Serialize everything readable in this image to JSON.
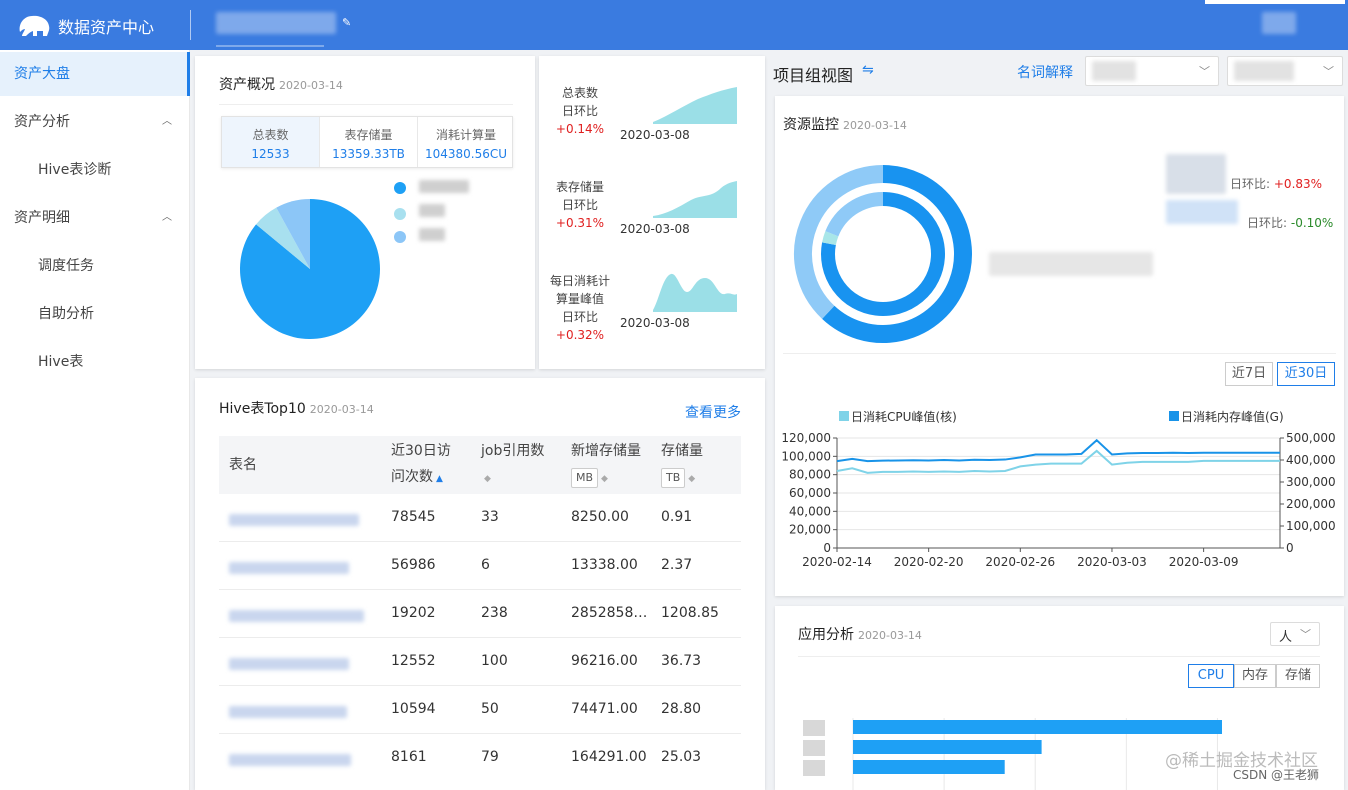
{
  "header": {
    "app_title": "数据资产中心",
    "edit_icon": "✎"
  },
  "sidebar": {
    "items": [
      {
        "label": "资产大盘"
      },
      {
        "label": "资产分析"
      },
      {
        "label": "Hive表诊断"
      },
      {
        "label": "资产明细"
      },
      {
        "label": "调度任务"
      },
      {
        "label": "自助分析"
      },
      {
        "label": "Hive表"
      }
    ]
  },
  "overview": {
    "title": "资产概况",
    "date": "2020-03-14",
    "tabs": [
      {
        "label": "总表数",
        "value": "12533"
      },
      {
        "label": "表存储量",
        "value": "13359.33TB"
      },
      {
        "label": "消耗计算量",
        "value": "104380.56CU"
      }
    ],
    "pie_shares": [
      0.86,
      0.06,
      0.08
    ],
    "colors": [
      "#1ea0f5",
      "#a8e0ef",
      "#8cc6f7"
    ]
  },
  "sparks": [
    {
      "label_lines": [
        "总表数",
        "日环比"
      ],
      "change": "+0.14%",
      "date": "2020-03-08"
    },
    {
      "label_lines": [
        "表存储量",
        "日环比"
      ],
      "change": "+0.31%",
      "date": "2020-03-08"
    },
    {
      "label_lines": [
        "每日消耗计",
        "算量峰值",
        "日环比"
      ],
      "change": "+0.32%",
      "date": "2020-03-08"
    }
  ],
  "hive_top": {
    "title": "Hive表Top10",
    "date": "2020-03-14",
    "more": "查看更多",
    "headers": {
      "name": "表名",
      "visits_l1": "近30日访",
      "visits_l2": "问次数",
      "jobs": "job引用数",
      "new_storage": "新增存储量",
      "new_storage_unit": "MB",
      "storage": "存储量",
      "storage_unit": "TB"
    },
    "rows": [
      {
        "visits": "78545",
        "jobs": "33",
        "new_storage": "8250.00",
        "storage": "0.91"
      },
      {
        "visits": "56986",
        "jobs": "6",
        "new_storage": "13338.00",
        "storage": "2.37"
      },
      {
        "visits": "19202",
        "jobs": "238",
        "new_storage": "2852858…",
        "storage": "1208.85"
      },
      {
        "visits": "12552",
        "jobs": "100",
        "new_storage": "96216.00",
        "storage": "36.73"
      },
      {
        "visits": "10594",
        "jobs": "50",
        "new_storage": "74471.00",
        "storage": "28.80"
      },
      {
        "visits": "8161",
        "jobs": "79",
        "new_storage": "164291.00",
        "storage": "25.03"
      }
    ]
  },
  "project": {
    "title": "项目组视图",
    "switch_icon": "⇋",
    "glossary": "名词解释"
  },
  "monitor": {
    "title": "资源监控",
    "date": "2020-03-14",
    "changes": [
      {
        "label": "日环比:",
        "value": "+0.83%",
        "dir": "up"
      },
      {
        "label": "日环比:",
        "value": "-0.10%",
        "dir": "down"
      }
    ],
    "ring_outer": [
      0.62,
      0.38
    ],
    "ring_inner": [
      0.78,
      0.03,
      0.19
    ],
    "range_buttons": [
      "近7日",
      "近30日"
    ],
    "legend": [
      "日消耗CPU峰值(核)",
      "日消耗内存峰值(G)"
    ],
    "colors": {
      "cpu": "#7fd3e8",
      "mem": "#1893e8",
      "ring_a": "#1893f0",
      "ring_b": "#8fcaf7",
      "ring_c": "#a8e6e8"
    }
  },
  "chart_data": {
    "type": "line",
    "x": [
      "2020-02-14",
      "2020-02-15",
      "2020-02-16",
      "2020-02-17",
      "2020-02-18",
      "2020-02-19",
      "2020-02-20",
      "2020-02-21",
      "2020-02-22",
      "2020-02-23",
      "2020-02-24",
      "2020-02-25",
      "2020-02-26",
      "2020-02-27",
      "2020-02-28",
      "2020-02-29",
      "2020-03-01",
      "2020-03-02",
      "2020-03-03",
      "2020-03-04",
      "2020-03-05",
      "2020-03-06",
      "2020-03-07",
      "2020-03-08",
      "2020-03-09",
      "2020-03-10",
      "2020-03-11",
      "2020-03-12",
      "2020-03-13",
      "2020-03-14"
    ],
    "x_ticks": [
      "2020-02-14",
      "2020-02-20",
      "2020-02-26",
      "2020-03-03",
      "2020-03-09"
    ],
    "series": [
      {
        "name": "日消耗CPU峰值(核)",
        "axis": "left",
        "values": [
          84000,
          87000,
          82000,
          83000,
          83000,
          83500,
          83000,
          83500,
          83000,
          84000,
          83500,
          84000,
          89000,
          91000,
          92000,
          92000,
          92000,
          106000,
          91000,
          93000,
          94000,
          94000,
          94000,
          94000,
          95000,
          95000,
          95000,
          95000,
          95000,
          95000
        ]
      },
      {
        "name": "日消耗内存峰值(G)",
        "axis": "right",
        "values": [
          395000,
          405000,
          395000,
          397000,
          398000,
          399000,
          398000,
          400000,
          398000,
          401000,
          400000,
          402000,
          412000,
          425000,
          425000,
          425000,
          428000,
          490000,
          425000,
          430000,
          432000,
          432000,
          433000,
          432000,
          433000,
          433000,
          433000,
          433000,
          433000,
          433000
        ]
      }
    ],
    "ylim_left": [
      0,
      120000
    ],
    "ylim_right": [
      0,
      500000
    ],
    "yticks_left": [
      "120,000",
      "100,000",
      "80,000",
      "60,000",
      "40,000",
      "20,000",
      "0"
    ],
    "yticks_right": [
      "500,000",
      "400,000",
      "300,000",
      "200,000",
      "100,000",
      "0"
    ]
  },
  "app_analysis": {
    "title": "应用分析",
    "date": "2020-03-14",
    "dropdown": "人",
    "tabs": [
      "CPU",
      "内存",
      "存储"
    ],
    "bars": [
      0.9,
      0.46,
      0.37
    ]
  },
  "watermark": {
    "line1": "@稀土掘金技术社区",
    "line2": "CSDN @王老狮"
  }
}
